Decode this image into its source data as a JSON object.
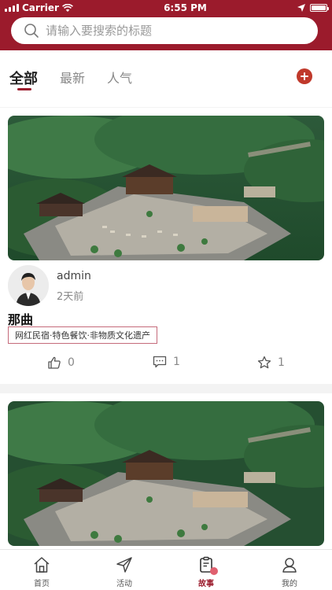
{
  "status_bar": {
    "carrier": "Carrier",
    "time": "6:55 PM"
  },
  "search": {
    "placeholder": "请输入要搜索的标题"
  },
  "tabs": [
    {
      "label": "全部",
      "active": true
    },
    {
      "label": "最新",
      "active": false
    },
    {
      "label": "人气",
      "active": false
    }
  ],
  "posts": [
    {
      "author": "admin",
      "time": "2天前",
      "title": "那曲",
      "tag": "网红民宿·特色餐饮·非物质文化遗产",
      "likes": "0",
      "comments": "1",
      "favorites": "1"
    },
    {
      "author": "",
      "time": "",
      "title": "",
      "tag": "",
      "likes": "",
      "comments": "",
      "favorites": ""
    }
  ],
  "bottom_nav": [
    {
      "label": "首页",
      "icon": "home-icon",
      "active": false
    },
    {
      "label": "活动",
      "icon": "send-icon",
      "active": false
    },
    {
      "label": "故事",
      "icon": "clipboard-icon",
      "active": true
    },
    {
      "label": "我的",
      "icon": "user-icon",
      "active": false
    }
  ],
  "colors": {
    "brand": "#9b1b2c",
    "accent": "#c0392b"
  }
}
